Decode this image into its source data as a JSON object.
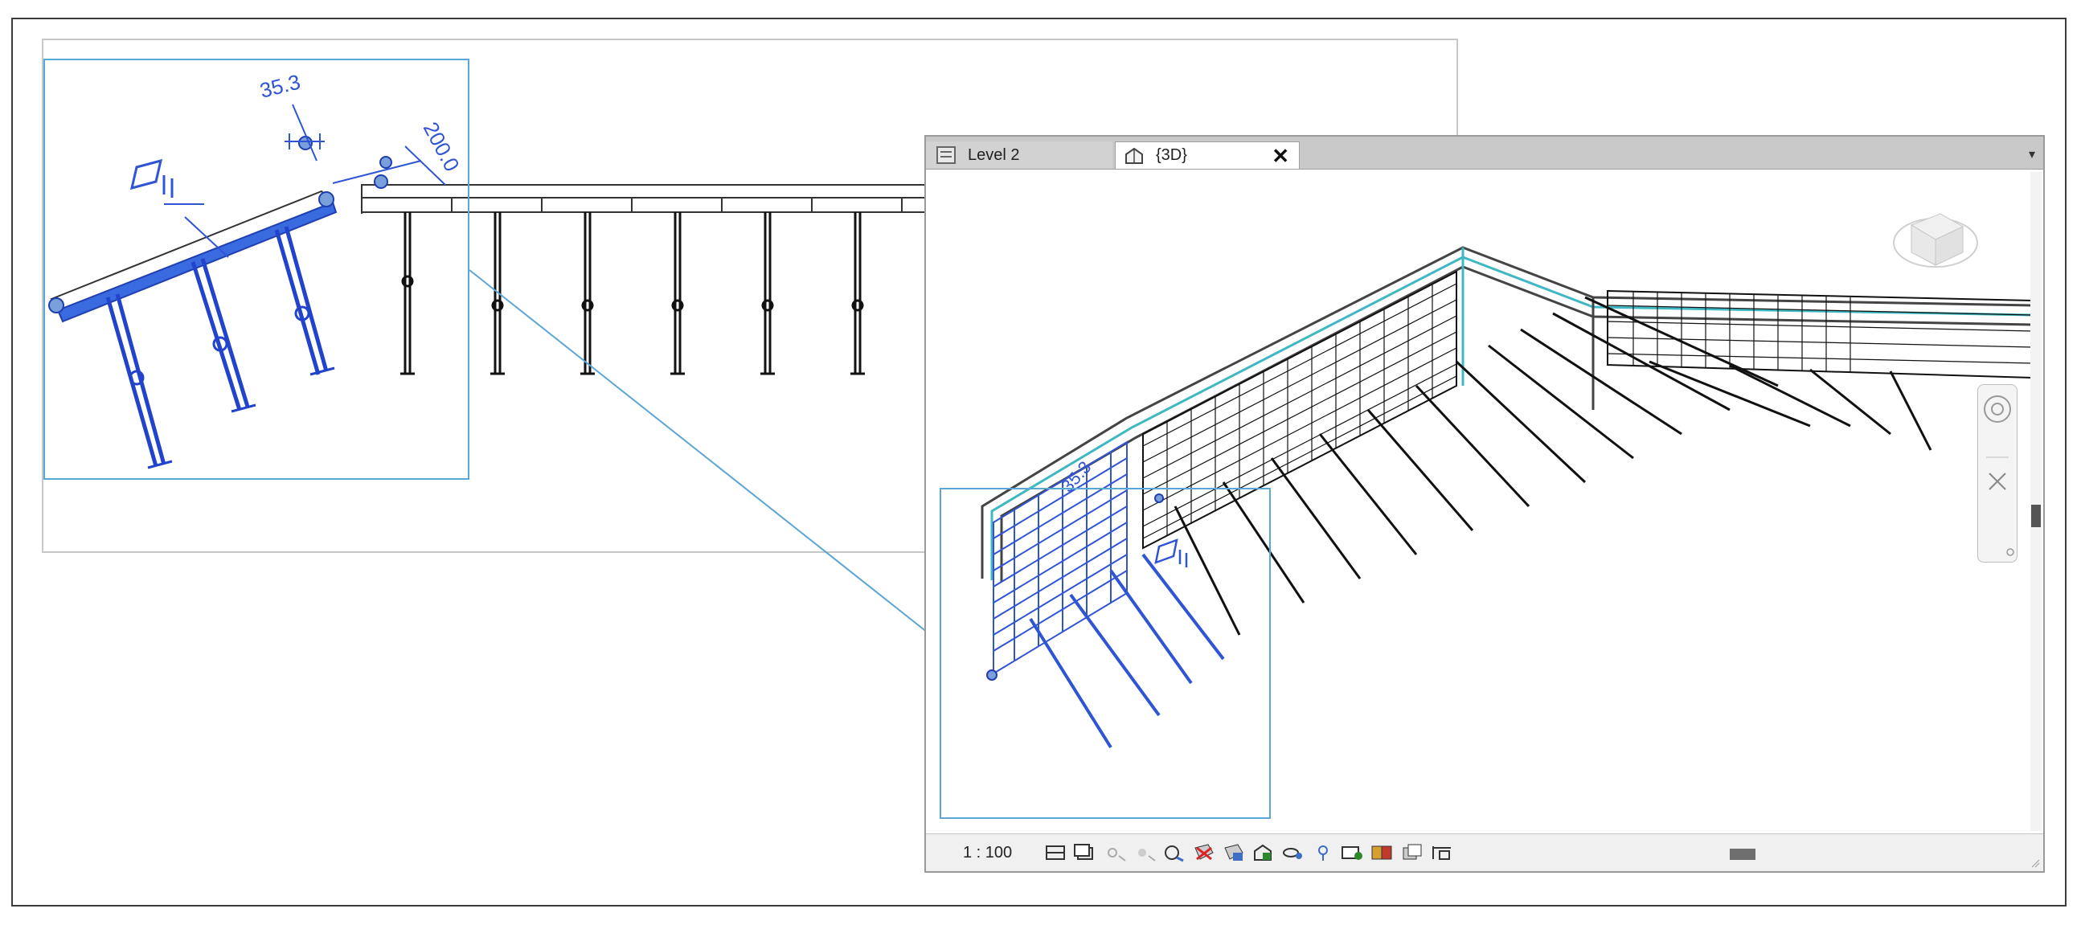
{
  "tabs": [
    {
      "label": "Level 2",
      "icon": "floor-plan-icon",
      "active": false
    },
    {
      "label": "{3D}",
      "icon": "3d-house-icon",
      "active": true
    }
  ],
  "plan_view": {
    "dimension_angle": "35.3",
    "dimension_offset": "200.0"
  },
  "view_3d": {
    "dimension_angle": "35.3"
  },
  "statusbar": {
    "scale": "1 : 100",
    "icons": [
      "detail-level-icon",
      "visual-style-icon",
      "sun-path-icon",
      "shadows-icon",
      "render-icon",
      "crop-view-icon",
      "show-crop-icon",
      "unlock-3d-icon",
      "temporary-hide-icon",
      "reveal-hidden-icon",
      "temporary-view-properties-icon",
      "hide-analytical-icon",
      "highlight-displacement-icon",
      "reveal-constraints-icon"
    ]
  },
  "colors": {
    "selection_blue": "#2f55d4",
    "detail_box": "#5aa6d6",
    "wall_cyan": "#3fb8c4",
    "formwork_black": "#111111"
  }
}
